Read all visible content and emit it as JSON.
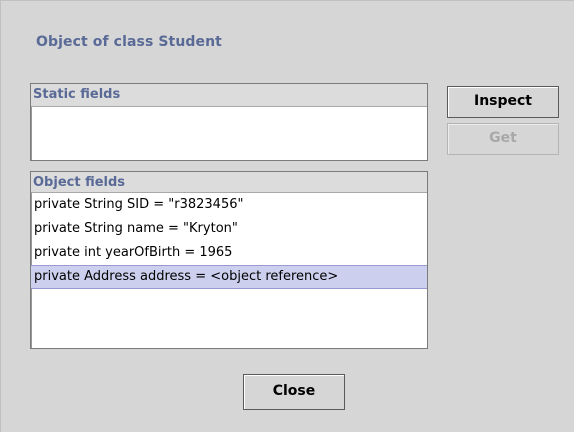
{
  "dialog": {
    "title": "Object of class Student"
  },
  "static_fields": {
    "header": "Static fields",
    "items": []
  },
  "object_fields": {
    "header": "Object fields",
    "items": [
      {
        "text": "private String SID = \"r3823456\"",
        "selected": false
      },
      {
        "text": "private String name = \"Kryton\"",
        "selected": false
      },
      {
        "text": "private int yearOfBirth = 1965",
        "selected": false
      },
      {
        "text": "private Address address = <object reference>",
        "selected": true
      }
    ]
  },
  "buttons": {
    "inspect": {
      "label": "Inspect",
      "enabled": true
    },
    "get": {
      "label": "Get",
      "enabled": false
    },
    "close": {
      "label": "Close",
      "enabled": true
    }
  }
}
